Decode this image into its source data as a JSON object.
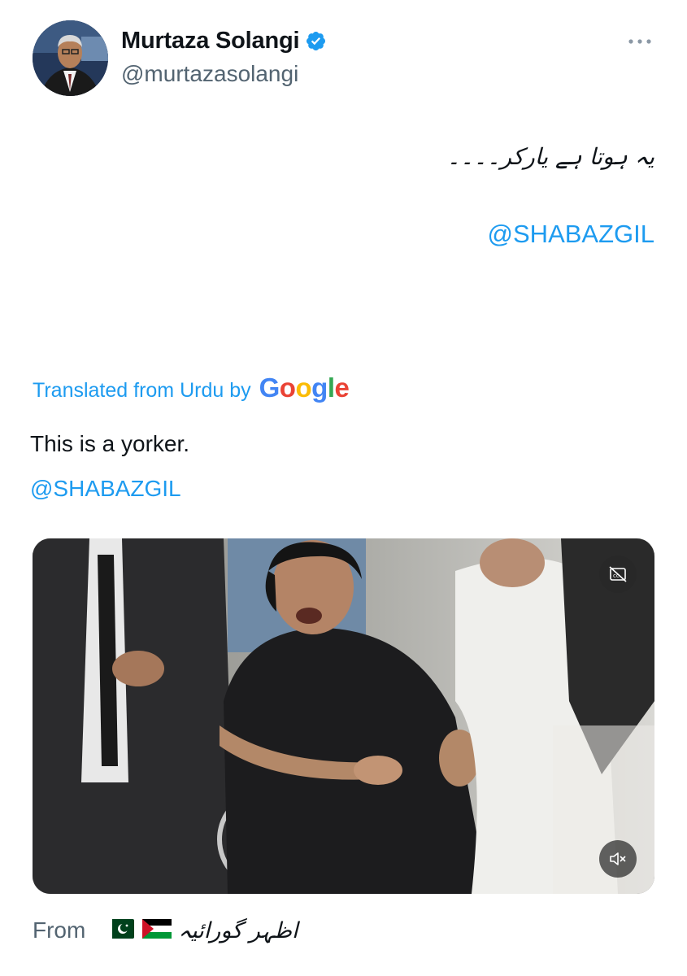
{
  "tweet": {
    "author": {
      "display_name": "Murtaza Solangi",
      "handle": "@murtazasolangi",
      "verified": true,
      "avatar_icon": "profile-photo",
      "verified_icon": "verified-badge-icon"
    },
    "more_icon": "more-options-icon",
    "original_text": "یہ ہوتا ہے یارکر۔۔۔۔",
    "mention": "@SHABAZGIL",
    "translation": {
      "label": "Translated from Urdu by",
      "provider_logo": "Google",
      "text": "This is a yorker.",
      "mention": "@SHABAZGIL"
    },
    "media": {
      "type": "video",
      "captions_icon": "closed-captions-off-icon",
      "mute_icon": "speaker-muted-icon"
    },
    "attribution": {
      "from_label": "From",
      "flags": [
        "pakistan-flag",
        "palestine-flag"
      ],
      "source_name": "اظہر گورائیہ"
    }
  },
  "colors": {
    "link": "#1d9bf0",
    "text": "#0f1419",
    "secondary": "#536471",
    "verified": "#1d9bf0"
  }
}
